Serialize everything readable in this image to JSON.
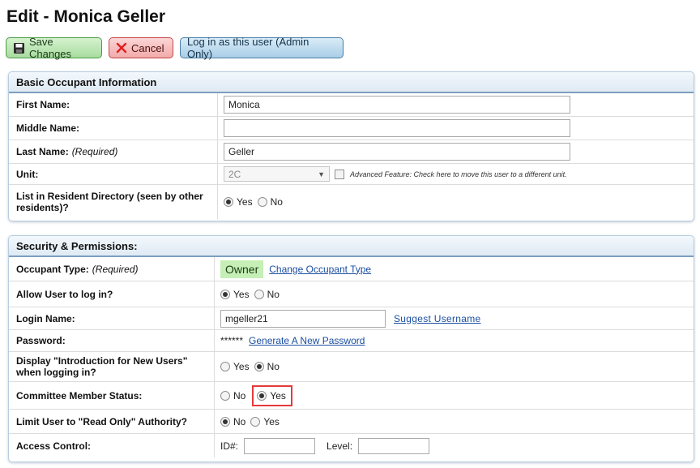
{
  "page": {
    "title": "Edit - Monica Geller"
  },
  "toolbar": {
    "save_label": "Save Changes",
    "cancel_label": "Cancel",
    "login_label": "Log in as this user (Admin Only)"
  },
  "basic": {
    "heading": "Basic Occupant Information",
    "first_name": {
      "label": "First Name:",
      "value": "Monica"
    },
    "middle_name": {
      "label": "Middle Name:",
      "value": ""
    },
    "last_name": {
      "label": "Last Name:",
      "required": "(Required)",
      "value": "Geller"
    },
    "unit": {
      "label": "Unit:",
      "value": "2C",
      "advanced_text": "Advanced Feature: Check here to move this user to a different unit."
    },
    "directory": {
      "label": "List in Resident Directory (seen by other residents)?",
      "options": [
        "Yes",
        "No"
      ],
      "selected": "Yes"
    }
  },
  "security": {
    "heading": "Security & Permissions:",
    "occupant_type": {
      "label": "Occupant Type:",
      "required": "(Required)",
      "value": "Owner",
      "change_link": "Change Occupant Type"
    },
    "allow_login": {
      "label": "Allow User to log in?",
      "options": [
        "Yes",
        "No"
      ],
      "selected": "Yes"
    },
    "login_name": {
      "label": "Login Name:",
      "value": "mgeller21",
      "suggest_link": "Suggest Username"
    },
    "password": {
      "label": "Password:",
      "masked": "******",
      "generate_link": "Generate A New Password"
    },
    "intro": {
      "label": "Display \"Introduction for New Users\" when logging in?",
      "options": [
        "Yes",
        "No"
      ],
      "selected": "No"
    },
    "committee": {
      "label": "Committee Member Status:",
      "options": [
        "No",
        "Yes"
      ],
      "selected": "Yes"
    },
    "read_only": {
      "label": "Limit User to \"Read Only\" Authority?",
      "options": [
        "No",
        "Yes"
      ],
      "selected": "No"
    },
    "access": {
      "label": "Access Control:",
      "id_label": "ID#:",
      "id_value": "",
      "level_label": "Level:",
      "level_value": ""
    }
  },
  "colors": {
    "save_green": "#a8dc9f",
    "cancel_red": "#f2a9a9",
    "login_blue": "#a9cde6",
    "owner_badge": "#c6efb6",
    "highlight": "#e5393b"
  }
}
